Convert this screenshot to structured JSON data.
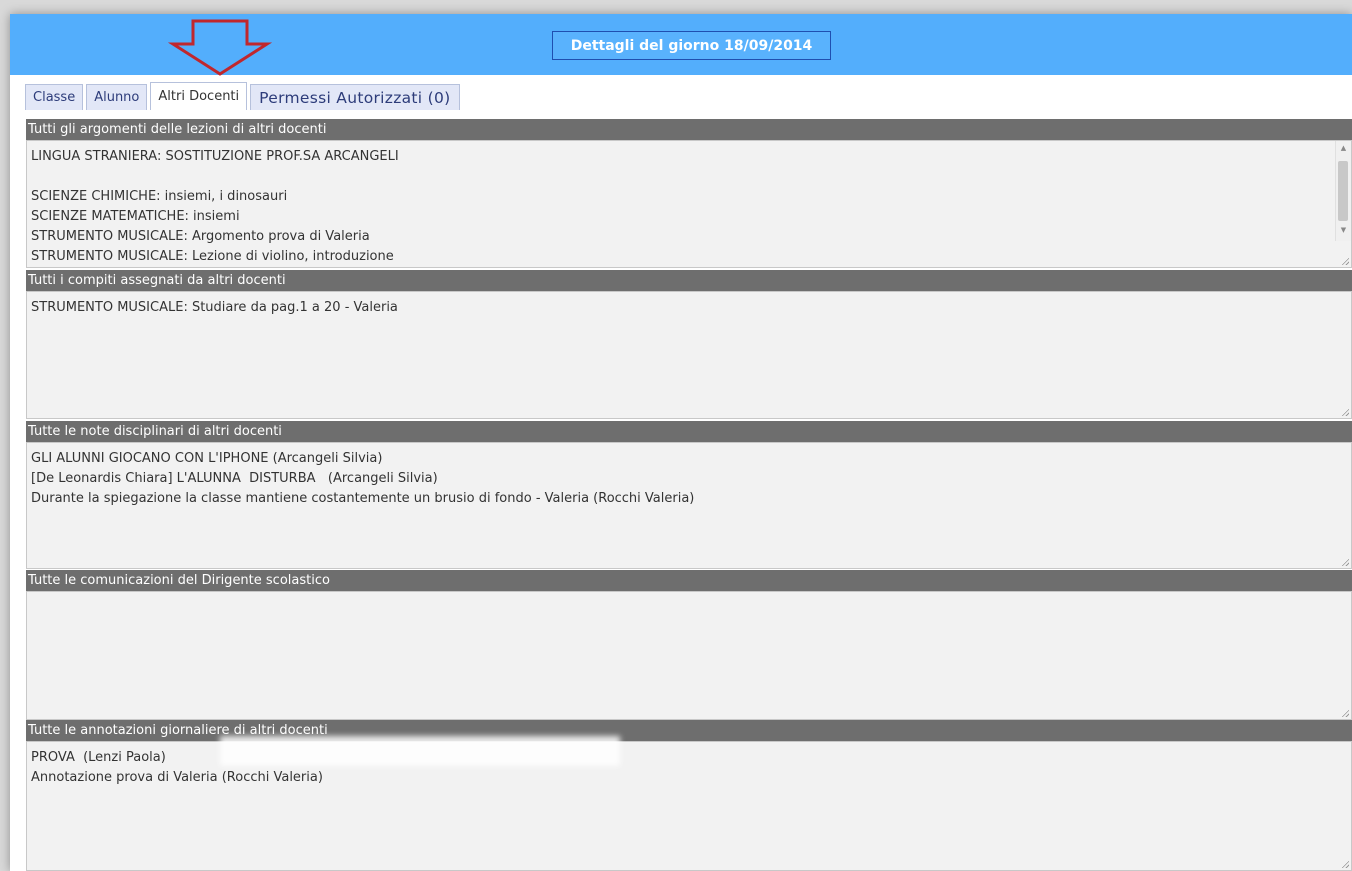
{
  "header": {
    "title": "Dettagli del giorno 18/09/2014",
    "accent_color": "#53aefc",
    "annotation_icon": "down-arrow-outline"
  },
  "tabs": [
    {
      "label": "Classe",
      "active": false
    },
    {
      "label": "Alunno",
      "active": false
    },
    {
      "label": "Altri Docenti",
      "active": true
    },
    {
      "label": "Permessi Autorizzati (0)",
      "active": false
    }
  ],
  "sections": {
    "argomenti": {
      "title": "Tutti gli argomenti delle lezioni di altri docenti",
      "lines": [
        "LINGUA STRANIERA: SOSTITUZIONE PROF.SA ARCANGELI",
        "",
        "SCIENZE CHIMICHE: insiemi, i dinosauri",
        "SCIENZE MATEMATICHE: insiemi",
        "STRUMENTO MUSICALE: Argomento prova di Valeria",
        "STRUMENTO MUSICALE: Lezione di violino, introduzione"
      ]
    },
    "compiti": {
      "title": "Tutti i compiti assegnati da altri docenti",
      "lines": [
        "STRUMENTO MUSICALE: Studiare da pag.1 a 20 - Valeria"
      ]
    },
    "note": {
      "title": "Tutte le note disciplinari di altri docenti",
      "lines": [
        "GLI ALUNNI GIOCANO CON L'IPHONE (Arcangeli Silvia)",
        "[De Leonardis Chiara] L'ALUNNA  DISTURBA   (Arcangeli Silvia)",
        "Durante la spiegazione la classe mantiene costantemente un brusio di fondo - Valeria (Rocchi Valeria)"
      ]
    },
    "comunicazioni": {
      "title": "Tutte le comunicazioni del Dirigente scolastico",
      "lines": []
    },
    "annotazioni": {
      "title": "Tutte le annotazioni giornaliere di altri docenti",
      "lines": [
        "PROVA  (Lenzi Paola)",
        "Annotazione prova di Valeria (Rocchi Valeria)"
      ]
    }
  }
}
